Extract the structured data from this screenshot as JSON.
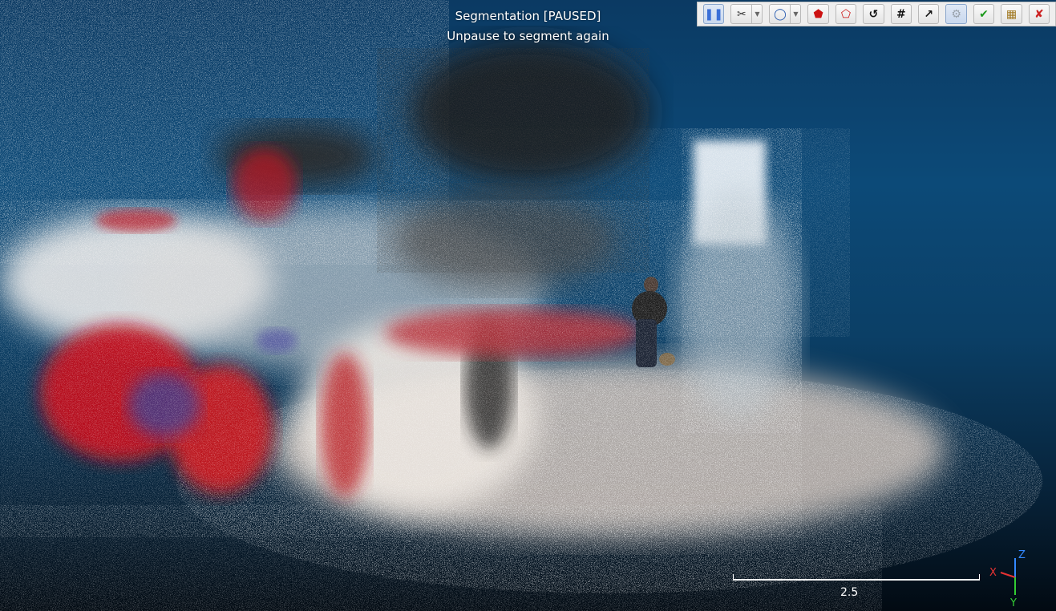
{
  "overlay": {
    "title": "Segmentation [PAUSED]",
    "subtitle": "Unpause to segment again"
  },
  "toolbar": {
    "buttons": [
      {
        "name": "pause-button",
        "icon": "pause-icon",
        "glyph": "❚❚",
        "color": "#3a6fd8",
        "active": true
      },
      {
        "name": "segment-mode-button",
        "icon": "scissors-icon",
        "glyph": "✂",
        "color": "#333333",
        "dropdown": true
      },
      {
        "name": "polygon-selection-button",
        "icon": "polygon-icon",
        "glyph": "◯",
        "color": "#2a5db0",
        "dropdown": true
      },
      {
        "name": "segment-in-button",
        "icon": "pentagon-in-icon",
        "glyph": "⬟",
        "color": "#cc1111"
      },
      {
        "name": "segment-out-button",
        "icon": "pentagon-out-icon",
        "glyph": "⬠",
        "color": "#cc1111"
      },
      {
        "name": "reset-button",
        "icon": "reset-icon",
        "glyph": "↺",
        "color": "#111111"
      },
      {
        "name": "options-button",
        "icon": "hash-icon",
        "glyph": "#",
        "color": "#111111"
      },
      {
        "name": "export-button",
        "icon": "export-icon",
        "glyph": "↗",
        "color": "#111111"
      },
      {
        "name": "settings-button",
        "icon": "gear-icon",
        "glyph": "⚙",
        "color": "#9aa3ad",
        "active": true
      },
      {
        "name": "confirm-button",
        "icon": "checkmark-icon",
        "glyph": "✔",
        "color": "#1e9a1e"
      },
      {
        "name": "confirm-delete-button",
        "icon": "delete-icon",
        "glyph": "▦",
        "color": "#a07820"
      },
      {
        "name": "cancel-button",
        "icon": "close-icon",
        "glyph": "✘",
        "color": "#cc2222"
      }
    ]
  },
  "scale_bar": {
    "label": "2.5"
  },
  "axis_triad": {
    "x_label": "X",
    "y_label": "Y",
    "z_label": "Z",
    "x_color": "#e83333",
    "y_color": "#33cc33",
    "z_color": "#3388ff"
  },
  "colors": {
    "background_top": "#0c4a78",
    "background_bottom": "#020a12"
  }
}
